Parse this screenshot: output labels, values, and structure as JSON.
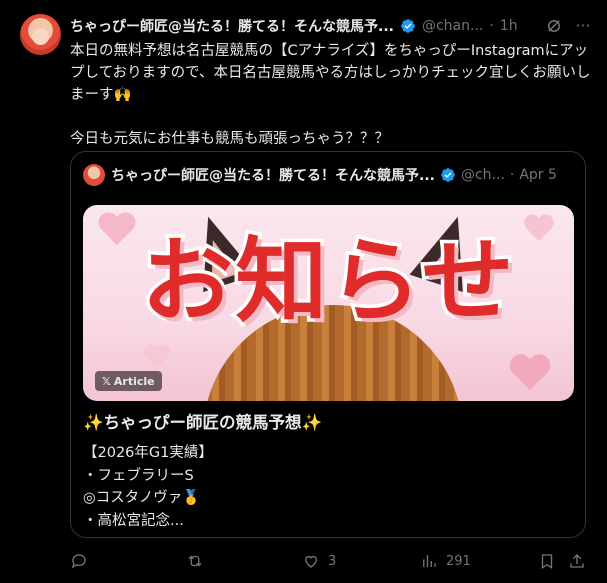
{
  "post": {
    "author_name": "ちゃっぴー師匠@当たる！勝てる！そんな競馬予...",
    "handle": "@chan...",
    "separator": "·",
    "time": "1h",
    "body_paragraph_1": "本日の無料予想は名古屋競馬の【Cアナライズ】をちゃっぴーInstagramにアップしておりますので、本日名古屋競馬やる方はしっかりチェック宜しくお願いしまーす🙌",
    "body_paragraph_2": "今日も元気にお仕事も競馬も頑張っちゃう？？？"
  },
  "quote": {
    "author_name": "ちゃっぴー師匠@当たる！勝てる！そんな競馬予...",
    "handle": "@ch...",
    "separator": "·",
    "time": "Apr 5",
    "image_heading": "お知らせ",
    "badge_label": "Article",
    "article_title": "✨ちゃっぴー師匠の競馬予想✨",
    "article_lines": [
      "【2026年G1実績】",
      "・フェブラリーS",
      "◎コスタノヴァ🥇",
      "・高松宮記念..."
    ]
  },
  "actions": {
    "reply_count": "",
    "repost_count": "",
    "like_count": "3",
    "views_count": "291"
  },
  "icons": {
    "verified": "verified-badge-icon",
    "grok": "grok-icon",
    "reply": "reply-icon",
    "repost": "repost-icon",
    "like": "like-icon",
    "views": "views-icon",
    "bookmark": "bookmark-icon",
    "share": "share-icon"
  },
  "colors": {
    "background": "#000000",
    "text": "#e7e9ea",
    "muted": "#71767b",
    "verified": "#1d9bf0",
    "border": "#2f3336"
  }
}
